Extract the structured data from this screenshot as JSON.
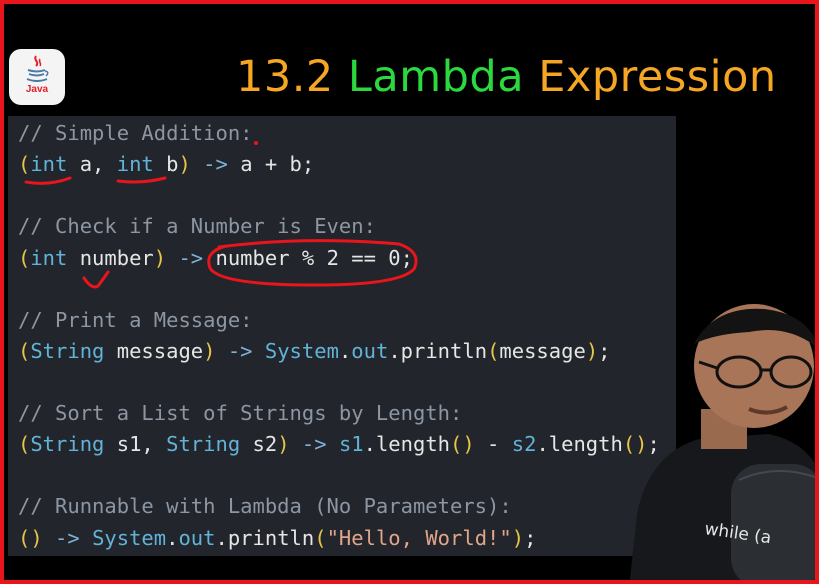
{
  "logo": {
    "label": "Java"
  },
  "title": {
    "number": "13.2",
    "word1": "Lambda",
    "word2": "Expression"
  },
  "code": {
    "l1": "// Simple Addition:",
    "l2a": "(",
    "l2b": "int",
    "l2c": " a, ",
    "l2d": "int",
    "l2e": " b",
    "l2f": ")",
    "l2g": " -> ",
    "l2h": "a + b;",
    "l3": "// Check if a Number is Even:",
    "l4a": "(",
    "l4b": "int",
    "l4c": " number",
    "l4d": ")",
    "l4e": " -> ",
    "l4f": "number % 2 == 0;",
    "l5": "// Print a Message:",
    "l6a": "(",
    "l6b": "String",
    "l6c": " message",
    "l6d": ")",
    "l6e": " -> ",
    "l6f": "System",
    "l6g": ".",
    "l6h": "out",
    "l6i": ".println",
    "l6j": "(",
    "l6k": "message",
    "l6l": ")",
    "l6m": ";",
    "l7": "// Sort a List of Strings by Length:",
    "l8a": "(",
    "l8b": "String",
    "l8c": " s1, ",
    "l8d": "String",
    "l8e": " s2",
    "l8f": ")",
    "l8g": " -> ",
    "l8h": "s1",
    "l8i": ".length",
    "l8j": "()",
    "l8k": " - ",
    "l8l": "s2",
    "l8m": ".length",
    "l8n": "()",
    "l8o": ";",
    "l9": "// Runnable with Lambda (No Parameters):",
    "l10a": "()",
    "l10b": " -> ",
    "l10c": "System",
    "l10d": ".",
    "l10e": "out",
    "l10f": ".println",
    "l10g": "(",
    "l10h": "\"Hello, World!\"",
    "l10i": ")",
    "l10j": ";"
  },
  "presenter": {
    "shirt_text": "while (a"
  },
  "colors": {
    "frame": "#e8161c",
    "annotation": "#e8161c",
    "title_orange": "#f5a623",
    "title_green": "#2bd93f"
  }
}
